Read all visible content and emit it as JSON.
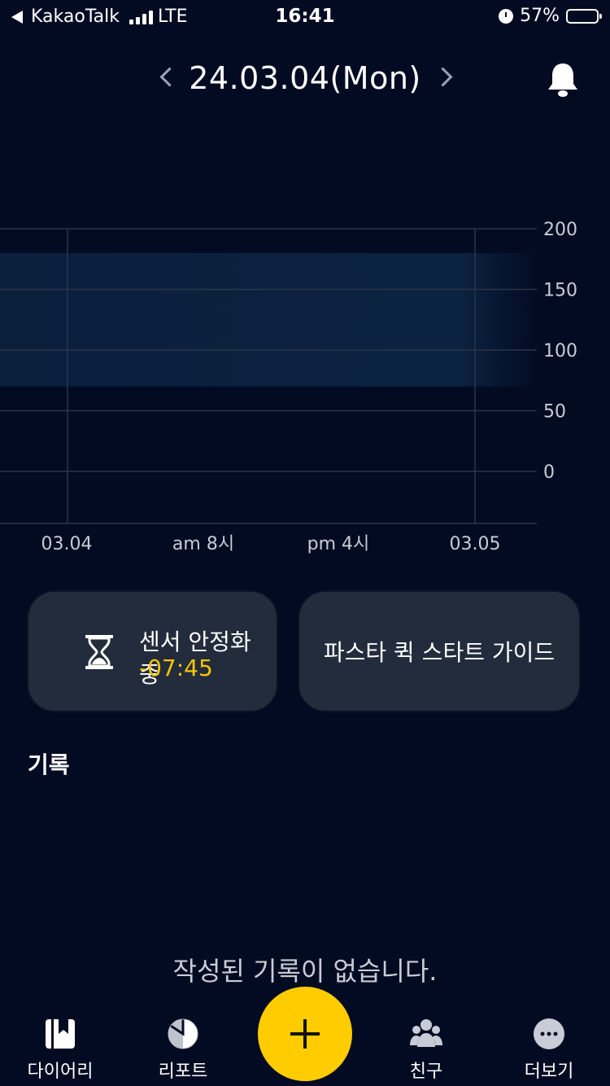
{
  "status_bar": {
    "carrier": "KakaoTalk",
    "network": "LTE",
    "time": "16:41",
    "battery": "57%",
    "battery_level": 0.57
  },
  "header": {
    "date": "24.03.04(Mon)",
    "prev_icon": "chevron-left-icon",
    "next_icon": "chevron-right-icon",
    "notification_icon": "bell-icon"
  },
  "chart_data": {
    "type": "line",
    "y_ticks": [
      "200",
      "150",
      "100",
      "50",
      "0"
    ],
    "ylim": [
      -20,
      200
    ],
    "x_ticks": [
      "03.04",
      "am 8시",
      "pm 4시",
      "03.05"
    ],
    "target_range": [
      70,
      180
    ],
    "series": [],
    "grid": true,
    "colors": {
      "target_band": "#0B2240",
      "grid": "#2A3448",
      "text": "#C7CCD6"
    }
  },
  "cards": {
    "sensor": {
      "icon": "hourglass-icon",
      "label": "센서 안정화 중",
      "timer": "-07:45"
    },
    "guide": {
      "label": "파스타 퀵 스타트 가이드"
    }
  },
  "records": {
    "title": "기록",
    "empty_message": "작성된 기록이 없습니다."
  },
  "tab_bar": {
    "tabs": [
      {
        "label": "다이어리",
        "icon": "diary-icon"
      },
      {
        "label": "리포트",
        "icon": "report-icon"
      },
      {
        "label": "친구",
        "icon": "friends-icon"
      },
      {
        "label": "더보기",
        "icon": "more-icon"
      }
    ],
    "fab_icon": "plus-icon"
  },
  "colors": {
    "background": "#030B22",
    "card": "#222C3C",
    "accent": "#FFCC00",
    "timer": "#F7C400"
  }
}
